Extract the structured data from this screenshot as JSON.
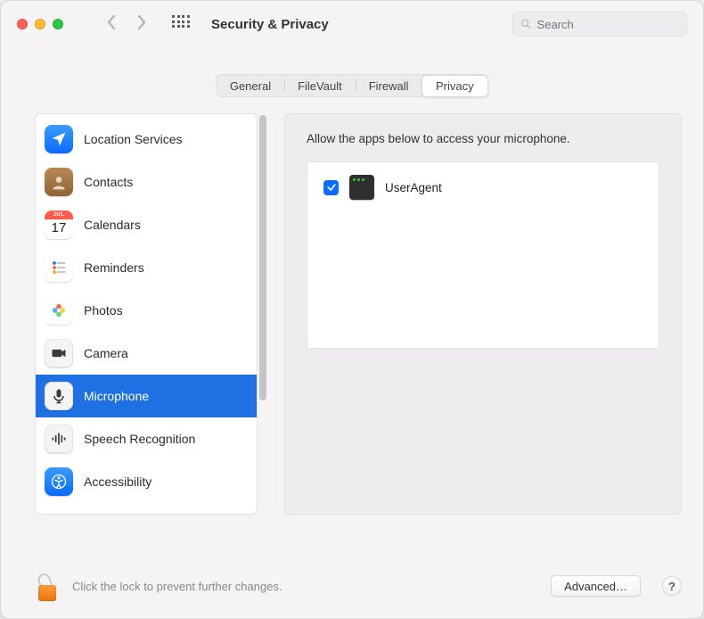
{
  "window": {
    "title": "Security & Privacy"
  },
  "search": {
    "placeholder": "Search"
  },
  "tabs": [
    {
      "id": "general",
      "label": "General",
      "active": false
    },
    {
      "id": "filevault",
      "label": "FileVault",
      "active": false
    },
    {
      "id": "firewall",
      "label": "Firewall",
      "active": false
    },
    {
      "id": "privacy",
      "label": "Privacy",
      "active": true
    }
  ],
  "sidebar": {
    "items": [
      {
        "id": "location",
        "label": "Location Services",
        "icon": "location-arrow-icon",
        "selected": false
      },
      {
        "id": "contacts",
        "label": "Contacts",
        "icon": "contacts-icon",
        "selected": false
      },
      {
        "id": "calendars",
        "label": "Calendars",
        "icon": "calendar-icon",
        "selected": false
      },
      {
        "id": "reminders",
        "label": "Reminders",
        "icon": "reminders-icon",
        "selected": false
      },
      {
        "id": "photos",
        "label": "Photos",
        "icon": "photos-icon",
        "selected": false
      },
      {
        "id": "camera",
        "label": "Camera",
        "icon": "camera-icon",
        "selected": false
      },
      {
        "id": "microphone",
        "label": "Microphone",
        "icon": "microphone-icon",
        "selected": true
      },
      {
        "id": "speech",
        "label": "Speech Recognition",
        "icon": "speech-icon",
        "selected": false
      },
      {
        "id": "accessibility",
        "label": "Accessibility",
        "icon": "accessibility-icon",
        "selected": false
      }
    ]
  },
  "calendar_icon": {
    "month": "JUL",
    "day": "17"
  },
  "panel": {
    "description": "Allow the apps below to access your microphone.",
    "apps": [
      {
        "name": "UserAgent",
        "checked": true,
        "icon": "terminal-app-icon"
      }
    ]
  },
  "footer": {
    "lock_text": "Click the lock to prevent further changes.",
    "advanced_label": "Advanced…",
    "help_label": "?"
  }
}
